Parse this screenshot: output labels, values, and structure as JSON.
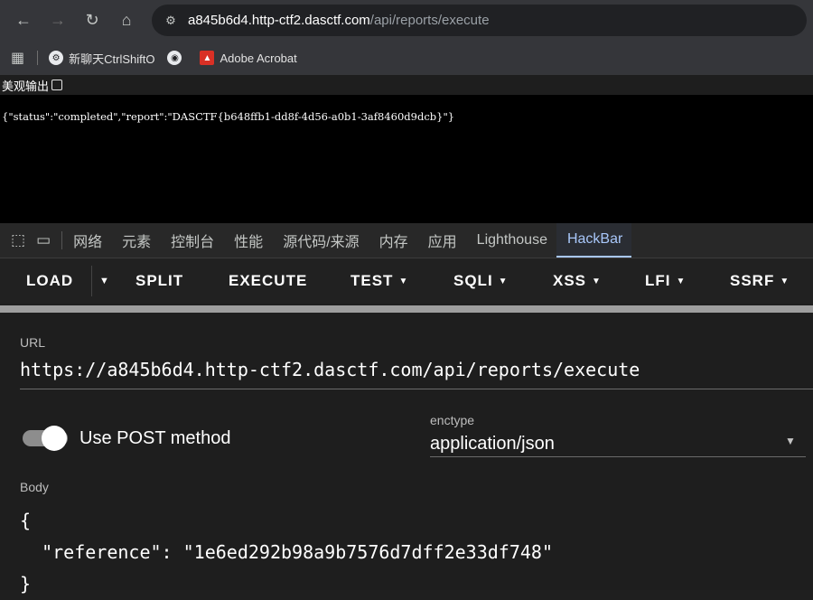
{
  "browser": {
    "nav": {
      "back_icon": "back-arrow-icon",
      "forward_icon": "forward-arrow-icon",
      "reload_icon": "reload-icon",
      "home_icon": "home-icon"
    },
    "address": {
      "host": "a845b6d4.http-ctf2.dasctf.com",
      "path": "/api/reports/execute"
    }
  },
  "bookmarks": [
    {
      "label": "新聊天CtrlShiftO",
      "icon": "chat-icon"
    },
    {
      "label": "",
      "icon": "globe-icon"
    },
    {
      "label": "Adobe Acrobat",
      "icon": "pdf-icon"
    }
  ],
  "page": {
    "pretty_print_label": "美观输出",
    "json_output": "{\"status\":\"completed\",\"report\":\"DASCTF{b648ffb1-dd8f-4d56-a0b1-3af8460d9dcb}\"}"
  },
  "devtools": {
    "tabs": [
      "网络",
      "元素",
      "控制台",
      "性能",
      "源代码/来源",
      "内存",
      "应用",
      "Lighthouse",
      "HackBar"
    ],
    "active_tab": "HackBar"
  },
  "hackbar": {
    "menu": {
      "load": "LOAD",
      "split": "SPLIT",
      "execute": "EXECUTE",
      "test": "TEST",
      "sqli": "SQLI",
      "xss": "XSS",
      "lfi": "LFI",
      "ssrf": "SSRF"
    },
    "url_label": "URL",
    "url_value": "https://a845b6d4.http-ctf2.dasctf.com/api/reports/execute",
    "post_toggle_label": "Use POST method",
    "post_enabled": true,
    "enctype_label": "enctype",
    "enctype_value": "application/json",
    "body_label": "Body",
    "body_value": "{\n  \"reference\": \"1e6ed292b98a9b7576d7dff2e33df748\"\n}"
  },
  "colors": {
    "accent": "#a8c7fa",
    "background": "#1e1e1e",
    "toolbar": "#35363a"
  }
}
